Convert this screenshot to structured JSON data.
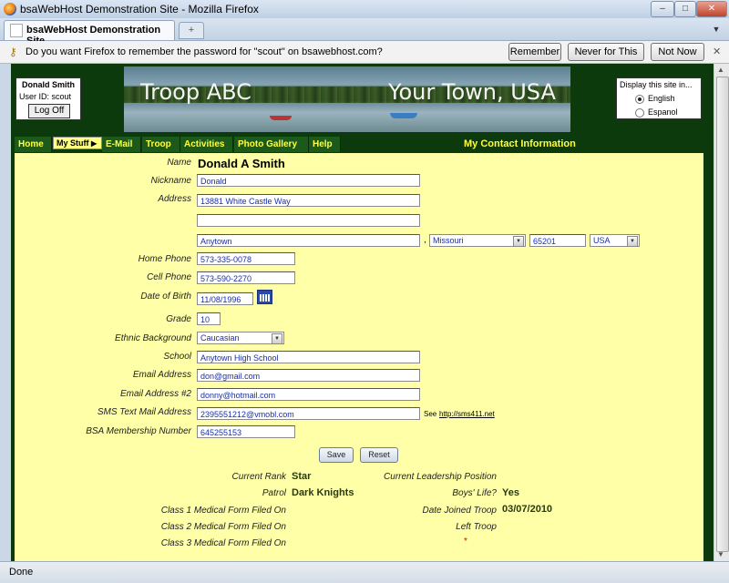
{
  "window": {
    "title": "bsaWebHost Demonstration Site - Mozilla Firefox",
    "tab_label": "bsaWebHost Demonstration Site",
    "new_tab": "+",
    "controls": [
      "–",
      "□",
      "✕"
    ]
  },
  "password_bar": {
    "message": "Do you want Firefox to remember the password for \"scout\" on bsawebhost.com?",
    "remember": "Remember",
    "never": "Never for This Site",
    "not_now": "Not Now"
  },
  "status": "Done",
  "user": {
    "name": "Donald Smith",
    "user_id": "User ID:  scout",
    "logoff": "Log Off"
  },
  "banner": {
    "left": "Troop ABC",
    "right": "Your Town, USA"
  },
  "language": {
    "heading": "Display this site in...",
    "options": [
      "English",
      "Espanol"
    ],
    "selected": "English"
  },
  "nav": {
    "items": [
      "Home",
      "My Stuff",
      "E-Mail",
      "Troop",
      "Activities",
      "Photo Gallery",
      "Help"
    ],
    "active": "My Stuff",
    "page_title": "My Contact Information"
  },
  "form": {
    "labels": {
      "name": "Name",
      "nickname": "Nickname",
      "address": "Address",
      "home_phone": "Home Phone",
      "cell_phone": "Cell Phone",
      "dob": "Date of Birth",
      "grade": "Grade",
      "ethnic": "Ethnic Background",
      "school": "School",
      "email": "Email Address",
      "email2": "Email Address #2",
      "sms": "SMS Text Mail Address",
      "bsa": "BSA Membership Number"
    },
    "values": {
      "name": "Donald A Smith",
      "nickname": "Donald",
      "address1": "13881 White Castle Way",
      "address2": "",
      "city": "Anytown",
      "state": "Missouri",
      "zip": "65201",
      "country": "USA",
      "home_phone": "573-335-0078",
      "cell_phone": "573-590-2270",
      "dob": "11/08/1996",
      "grade": "10",
      "ethnic": "Caucasian",
      "school": "Anytown High School",
      "email": "don@gmail.com",
      "email2": "donny@hotmail.com",
      "sms": "2395551212@vmobl.com",
      "bsa": "645255153"
    },
    "comma": ",",
    "sms_see": "See",
    "sms_link": "http://sms411.net",
    "save": "Save",
    "reset": "Reset"
  },
  "info": {
    "current_rank_label": "Current Rank",
    "current_rank": "Star",
    "patrol_label": "Patrol",
    "patrol": "Dark Knights",
    "class1_label": "Class 1 Medical Form Filed On",
    "class2_label": "Class 2 Medical Form Filed On",
    "class3_label": "Class 3 Medical Form Filed On",
    "leadership_label": "Current Leadership Position",
    "leadership": "",
    "boys_life_label": "Boys' Life?",
    "boys_life": "Yes",
    "date_joined_label": "Date Joined Troop",
    "date_joined": "03/07/2010",
    "left_troop_label": "Left Troop",
    "required_mark": "*"
  }
}
